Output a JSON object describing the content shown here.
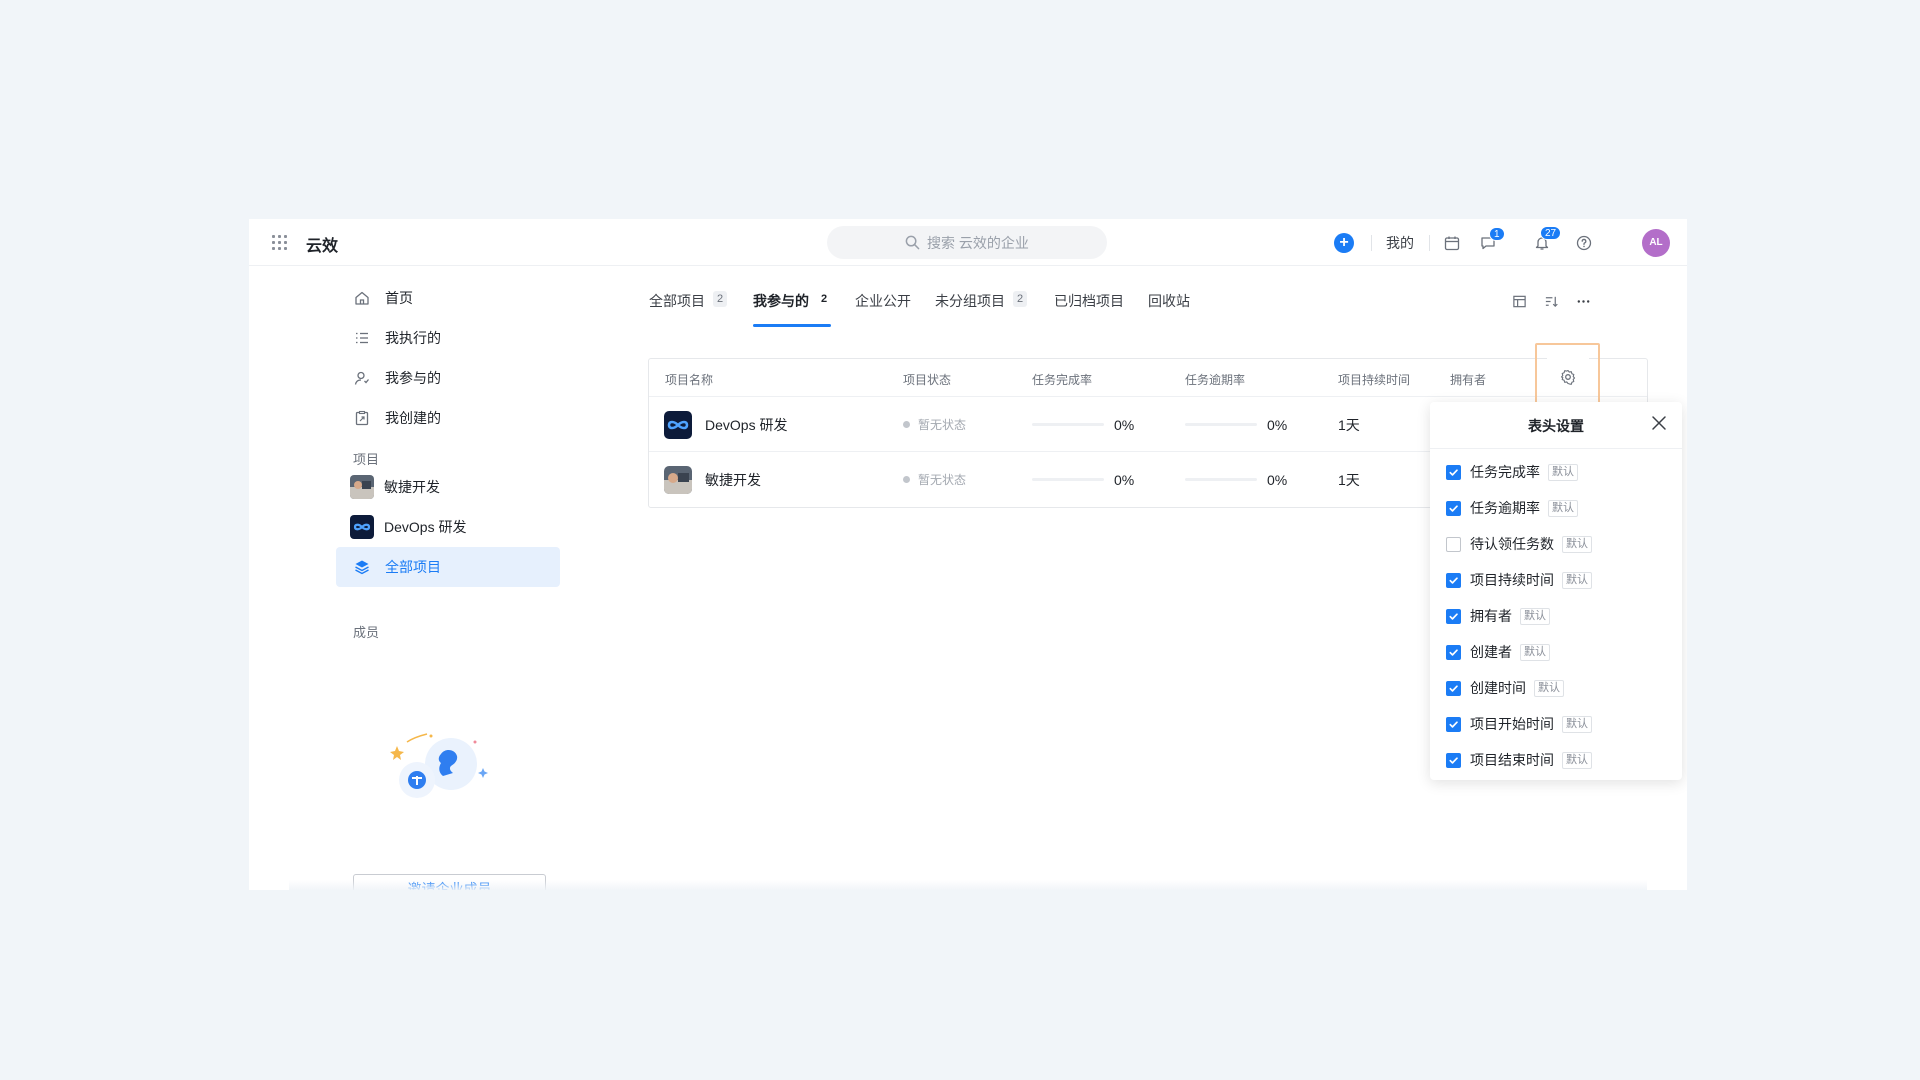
{
  "topbar": {
    "brand": "云效",
    "search_placeholder": "搜索 云效的企业",
    "mine_label": "我的",
    "message_badge": "1",
    "notify_badge": "27",
    "avatar_text": "AL"
  },
  "sidebar": {
    "nav": [
      {
        "label": "首页",
        "icon": "home-icon"
      },
      {
        "label": "我执行的",
        "icon": "task-list-icon"
      },
      {
        "label": "我参与的",
        "icon": "user-icon"
      },
      {
        "label": "我创建的",
        "icon": "created-doc-icon"
      }
    ],
    "projects_title": "项目",
    "projects": [
      {
        "label": "敏捷开发"
      },
      {
        "label": "DevOps 研发"
      }
    ],
    "all_projects": "全部项目",
    "members_title": "成员",
    "invite_label": "邀请企业成员"
  },
  "tabs": [
    {
      "label": "全部项目",
      "count": "2"
    },
    {
      "label": "我参与的",
      "count": "2",
      "active": true
    },
    {
      "label": "企业公开"
    },
    {
      "label": "未分组项目",
      "count": "2"
    },
    {
      "label": "已归档项目"
    },
    {
      "label": "回收站"
    }
  ],
  "table": {
    "headers": [
      "项目名称",
      "项目状态",
      "任务完成率",
      "任务逾期率",
      "项目持续时间",
      "拥有者"
    ],
    "rows": [
      {
        "name": "DevOps 研发",
        "status": "暂无状态",
        "completion": "0%",
        "overdue": "0%",
        "duration": "1天"
      },
      {
        "name": "敏捷开发",
        "status": "暂无状态",
        "completion": "0%",
        "overdue": "0%",
        "duration": "1天"
      }
    ]
  },
  "popup": {
    "title": "表头设置",
    "default_tag": "默认",
    "options": [
      {
        "label": "任务完成率",
        "checked": true
      },
      {
        "label": "任务逾期率",
        "checked": true
      },
      {
        "label": "待认领任务数",
        "checked": false
      },
      {
        "label": "项目持续时间",
        "checked": true
      },
      {
        "label": "拥有者",
        "checked": true
      },
      {
        "label": "创建者",
        "checked": true
      },
      {
        "label": "创建时间",
        "checked": true
      },
      {
        "label": "项目开始时间",
        "checked": true
      },
      {
        "label": "项目结束时间",
        "checked": true
      }
    ]
  },
  "colors": {
    "accent": "#1b7cf5",
    "highlight_border": "#f7c79a",
    "avatar": "#b36ec9"
  }
}
